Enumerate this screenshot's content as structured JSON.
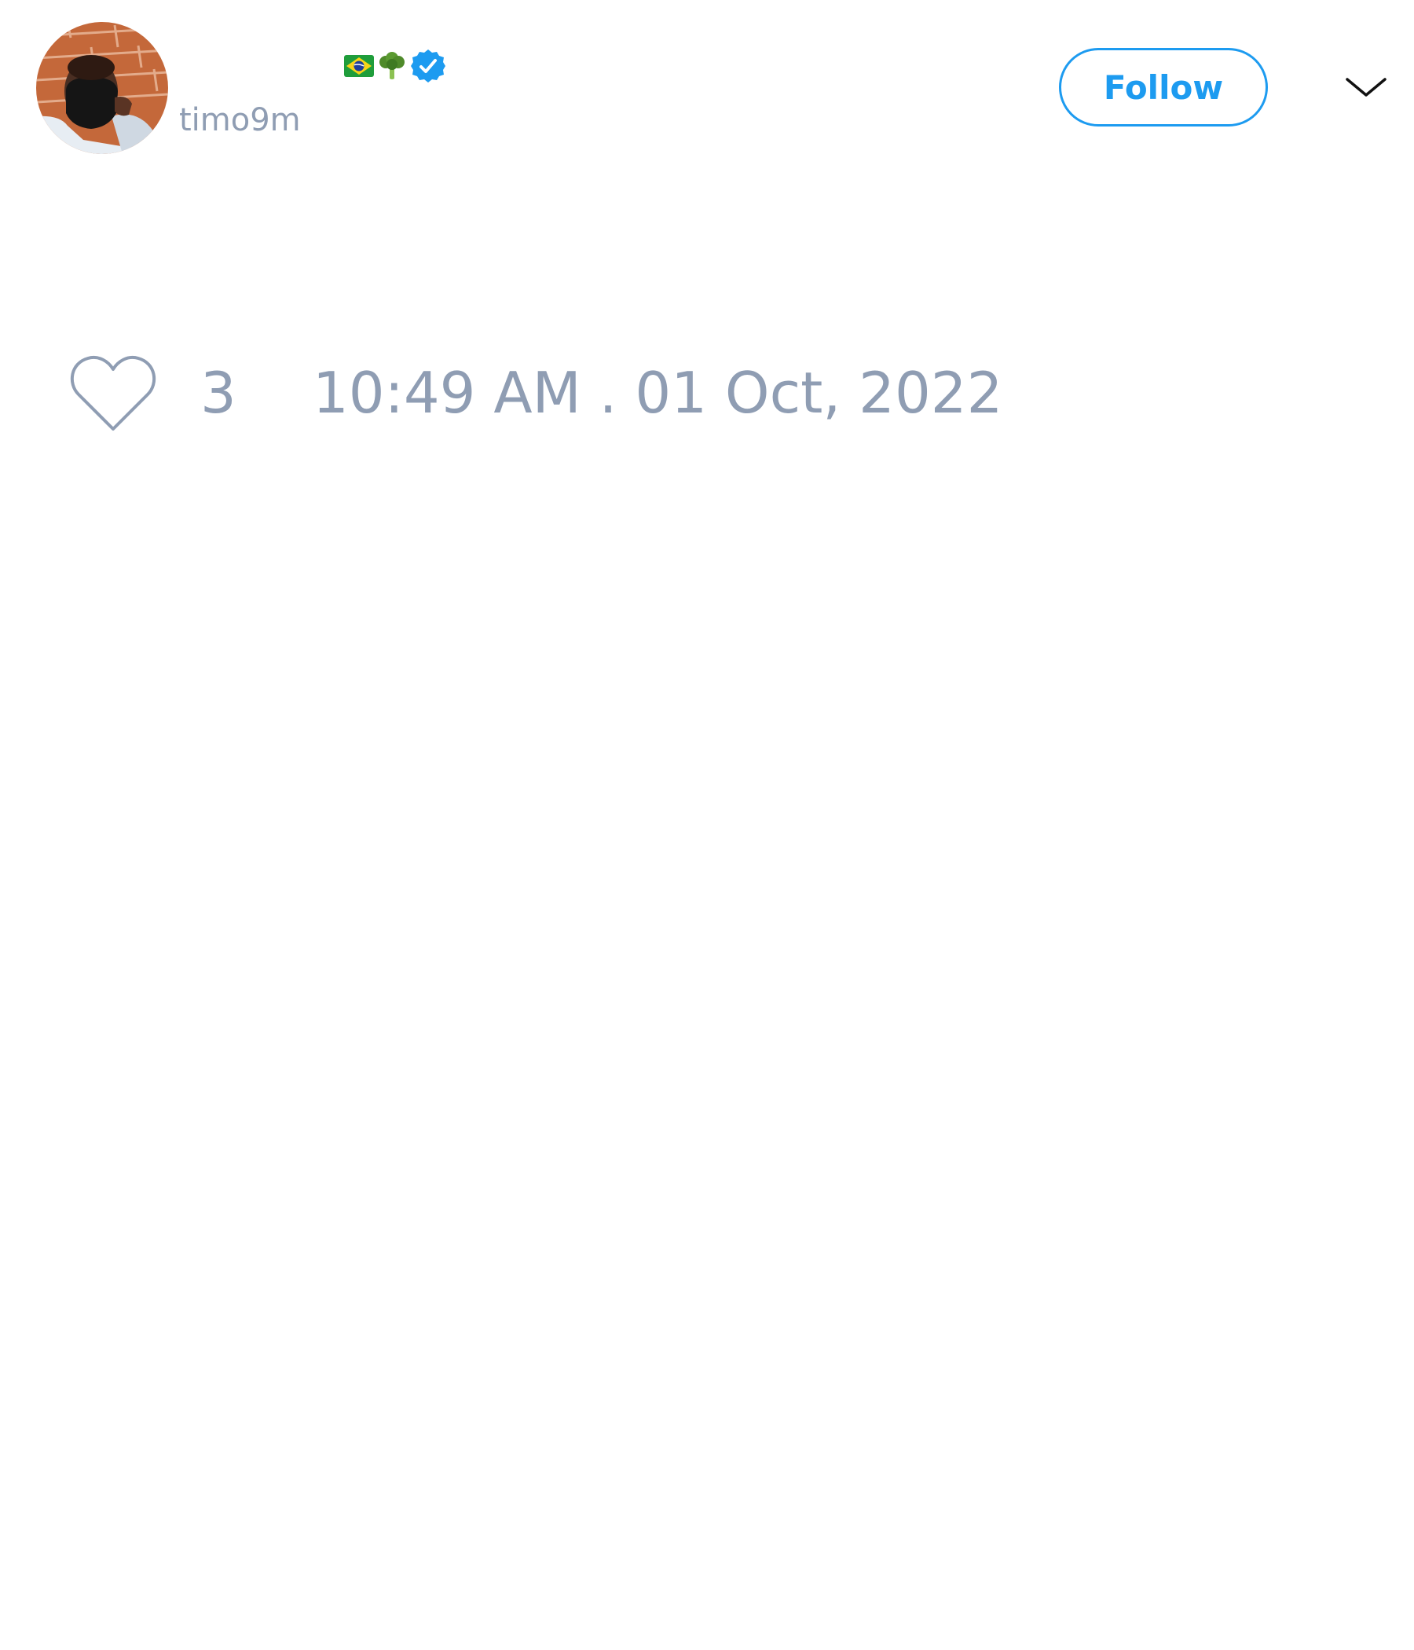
{
  "tweet": {
    "author": {
      "handle": "timo9m",
      "name_emojis": [
        "brazil-flag",
        "broccoli"
      ],
      "verified": true
    },
    "follow_button_label": "Follow",
    "likes": "3",
    "timestamp": "10:49 AM . 01 Oct, 2022"
  },
  "colors": {
    "accent": "#1d9bf0",
    "muted_text": "#8f9db3",
    "background": "#ffffff"
  },
  "icons": {
    "more": "chevron-down-icon",
    "like": "heart-outline-icon",
    "verified": "verified-badge-icon"
  }
}
